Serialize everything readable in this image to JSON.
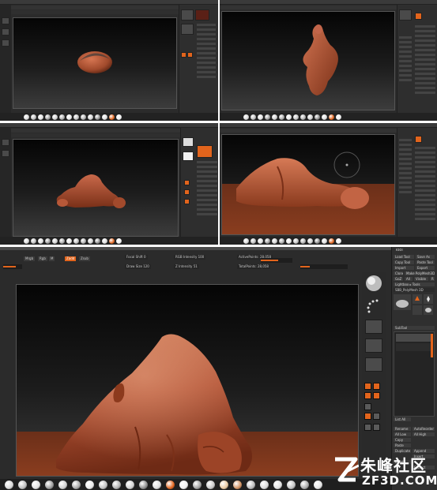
{
  "panels": [
    {
      "id": "stage-1",
      "description_label": ""
    },
    {
      "id": "stage-2",
      "description_label": ""
    },
    {
      "id": "stage-3",
      "description_label": ""
    },
    {
      "id": "stage-4",
      "description_label": ""
    },
    {
      "id": "stage-5",
      "description_label": ""
    }
  ],
  "toolbar": {
    "draw_size": "Draw Size 120",
    "focal_shift": "Focal Shift 0",
    "z_intensity": "Z Intensity 51",
    "rgb_intensity": "RGB Intensity 100",
    "mrgb": "Mrgb",
    "rgb": "Rgb",
    "m": "M",
    "zadd": "Zadd",
    "zsub": "Zsub",
    "active_points": "ActivePoints: 28,058",
    "total_points": "TotalPoints: 28,058"
  },
  "tool_panel": {
    "title": "Tool",
    "load_tool": "Load Tool",
    "save_as": "Save As",
    "copy_tool": "Copy Tool",
    "paste_tool": "Paste Tool",
    "import": "Import",
    "export": "Export",
    "clone": "Clone",
    "make_polymesh": "Make PolyMesh3D",
    "goz": "GoZ",
    "all": "All",
    "visible": "Visible",
    "r": "R",
    "lightbox_tools": "Lightbox ▸ Tools",
    "current_tool": "SBB_PolyMesh 3D",
    "subtool": "SubTool",
    "list_all": "List All",
    "rename": "Rename",
    "autoreorder": "AutoReorder",
    "all_low": "All Low",
    "all_high": "All High",
    "copy": "Copy",
    "paste": "Paste",
    "duplicate": "Duplicate",
    "append": "Append",
    "insert": "Insert",
    "delete": "Delete",
    "extract": "Extract"
  },
  "watermark": {
    "cn": "朱峰社区",
    "en": "ZF3D.COM"
  },
  "colors": {
    "accent": "#e2641c",
    "clay": "#b5553a",
    "ui_bg": "#2b2b2b"
  }
}
